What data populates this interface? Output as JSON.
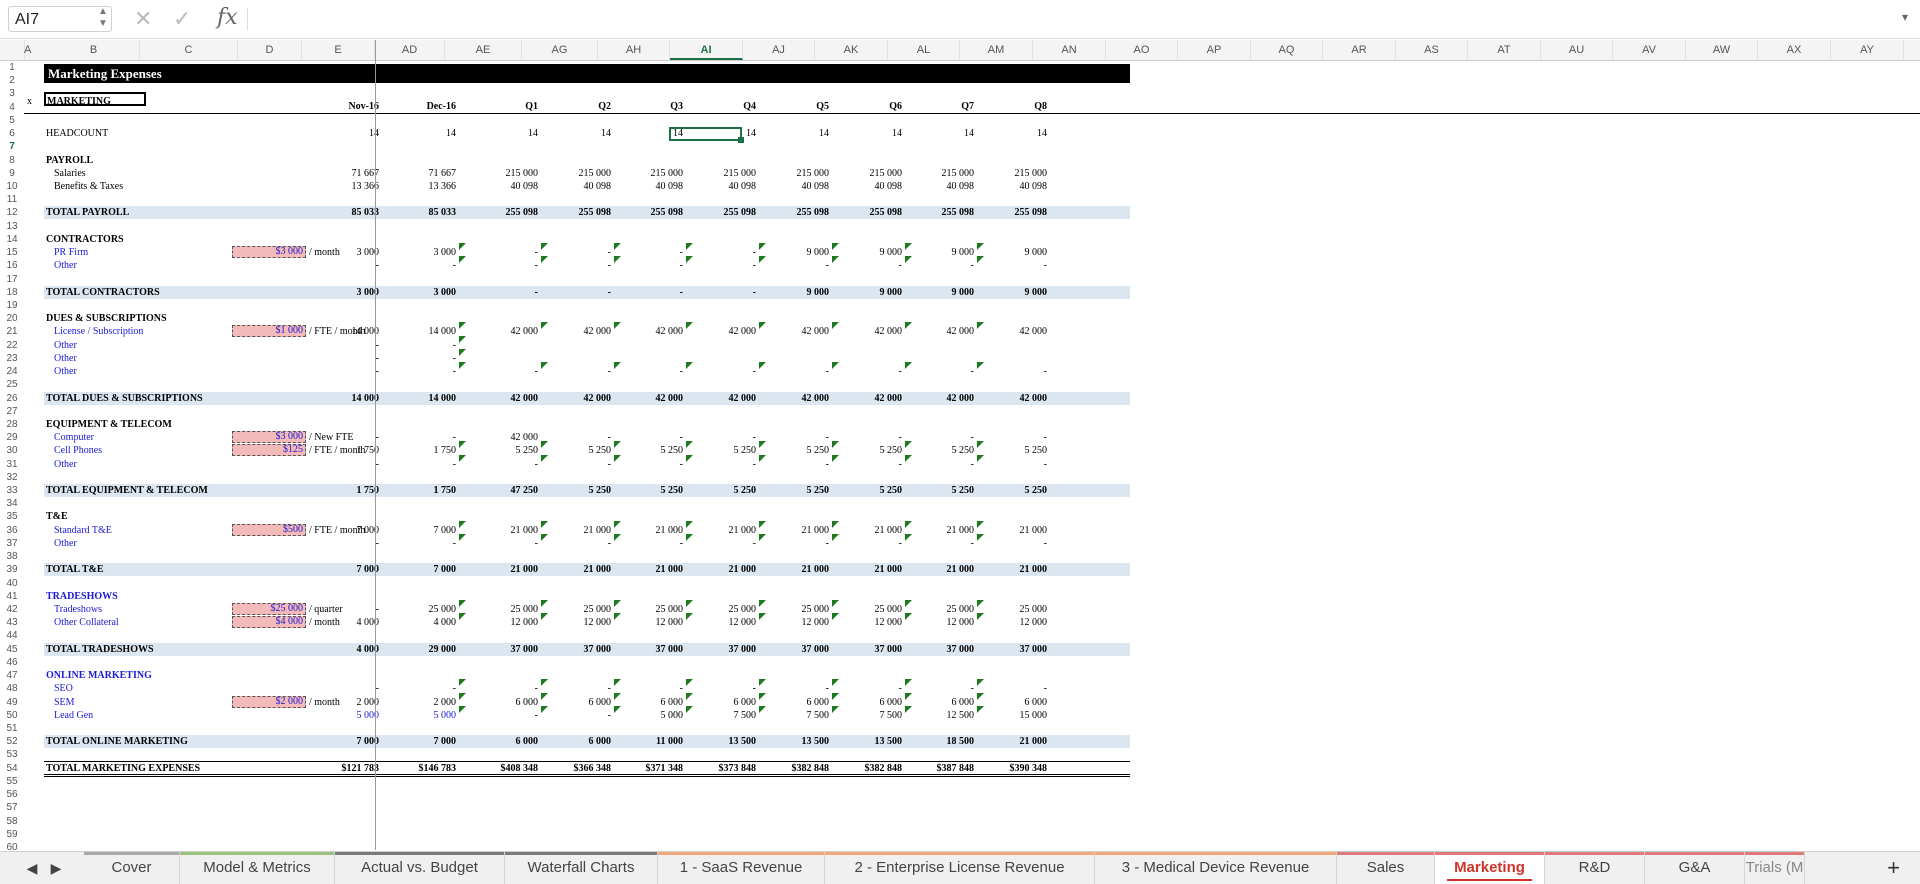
{
  "formula_bar": {
    "name_box": "AI7",
    "cancel": "✕",
    "enter": "✓",
    "fx": "fx",
    "content": ""
  },
  "columns": [
    "A",
    "B",
    "C",
    "D",
    "E",
    "AD",
    "AE",
    "AG",
    "AH",
    "AI",
    "AJ",
    "AK",
    "AL",
    "AM",
    "AN",
    "AO",
    "AP",
    "AQ",
    "AR",
    "AS",
    "AT",
    "AU",
    "AV",
    "AW",
    "AX",
    "AY"
  ],
  "selected_column": "AI",
  "selected_row": "7",
  "rows": [
    "1",
    "2",
    "3",
    "4",
    "5",
    "6",
    "7",
    "8",
    "9",
    "10",
    "11",
    "12",
    "13",
    "14",
    "15",
    "16",
    "17",
    "18",
    "19",
    "20",
    "21",
    "22",
    "23",
    "24",
    "25",
    "26",
    "27",
    "28",
    "29",
    "30",
    "31",
    "32",
    "33",
    "34",
    "35",
    "36",
    "37",
    "38",
    "39",
    "40",
    "41",
    "42",
    "43",
    "44",
    "45",
    "46",
    "47",
    "48",
    "49",
    "50",
    "51",
    "52",
    "53",
    "54",
    "55",
    "56",
    "57",
    "58",
    "59",
    "60"
  ],
  "sheet": {
    "title": "Marketing Expenses",
    "header_label": "MARKETING",
    "x_mark": "x",
    "periods": [
      "Nov-16",
      "Dec-16",
      "Q1",
      "Q2",
      "Q3",
      "Q4",
      "Q5",
      "Q6",
      "Q7",
      "Q8"
    ],
    "lines": [
      {
        "label": "HEADCOUNT",
        "kind": "plain",
        "values": [
          "14",
          "14",
          "14",
          "14",
          "14",
          "14",
          "14",
          "14",
          "14",
          "14"
        ]
      },
      {
        "label": "PAYROLL",
        "kind": "section"
      },
      {
        "label": "Salaries",
        "kind": "sub-black",
        "values": [
          "71 667",
          "71 667",
          "215 000",
          "215 000",
          "215 000",
          "215 000",
          "215 000",
          "215 000",
          "215 000",
          "215 000"
        ]
      },
      {
        "label": "Benefits & Taxes",
        "kind": "sub-black",
        "values": [
          "13 366",
          "13 366",
          "40 098",
          "40 098",
          "40 098",
          "40 098",
          "40 098",
          "40 098",
          "40 098",
          "40 098"
        ]
      },
      {
        "label": "TOTAL PAYROLL",
        "kind": "total",
        "values": [
          "85 033",
          "85 033",
          "255 098",
          "255 098",
          "255 098",
          "255 098",
          "255 098",
          "255 098",
          "255 098",
          "255 098"
        ]
      },
      {
        "label": "CONTRACTORS",
        "kind": "section"
      },
      {
        "label": "PR Firm",
        "kind": "sub",
        "assumption": "$3 000",
        "unit": "/ month",
        "values": [
          "3 000",
          "3 000",
          "-",
          "-",
          "-",
          "-",
          "9 000",
          "9 000",
          "9 000",
          "9 000"
        ]
      },
      {
        "label": "Other",
        "kind": "sub",
        "values": [
          "-",
          "-",
          "-",
          "-",
          "-",
          "-",
          "-",
          "-",
          "-",
          "-"
        ]
      },
      {
        "label": "TOTAL CONTRACTORS",
        "kind": "total",
        "values": [
          "3 000",
          "3 000",
          "-",
          "-",
          "-",
          "-",
          "9 000",
          "9 000",
          "9 000",
          "9 000"
        ]
      },
      {
        "label": "DUES & SUBSCRIPTIONS",
        "kind": "section"
      },
      {
        "label": "License / Subscription",
        "kind": "sub",
        "assumption": "$1 000",
        "unit": "/ FTE / month",
        "values": [
          "14 000",
          "14 000",
          "42 000",
          "42 000",
          "42 000",
          "42 000",
          "42 000",
          "42 000",
          "42 000",
          "42 000"
        ]
      },
      {
        "label": "Other",
        "kind": "sub",
        "values": [
          "-",
          "-",
          "",
          "",
          "",
          "",
          "",
          "",
          "",
          ""
        ]
      },
      {
        "label": "Other",
        "kind": "sub",
        "values": [
          "-",
          "-",
          "",
          "",
          "",
          "",
          "",
          "",
          "",
          ""
        ]
      },
      {
        "label": "Other",
        "kind": "sub",
        "values": [
          "-",
          "-",
          "-",
          "-",
          "-",
          "-",
          "-",
          "-",
          "-",
          "-"
        ]
      },
      {
        "label": "TOTAL DUES & SUBSCRIPTIONS",
        "kind": "total",
        "values": [
          "14 000",
          "14 000",
          "42 000",
          "42 000",
          "42 000",
          "42 000",
          "42 000",
          "42 000",
          "42 000",
          "42 000"
        ]
      },
      {
        "label": "EQUIPMENT & TELECOM",
        "kind": "section"
      },
      {
        "label": "Computer",
        "kind": "sub",
        "assumption": "$3 000",
        "unit": "/ New FTE",
        "values": [
          "-",
          "-",
          "42 000",
          "-",
          "-",
          "-",
          "-",
          "-",
          "-",
          "-"
        ]
      },
      {
        "label": "Cell Phones",
        "kind": "sub",
        "assumption": "$125",
        "unit": "/ FTE / month",
        "values": [
          "1 750",
          "1 750",
          "5 250",
          "5 250",
          "5 250",
          "5 250",
          "5 250",
          "5 250",
          "5 250",
          "5 250"
        ]
      },
      {
        "label": "Other",
        "kind": "sub",
        "values": [
          "-",
          "-",
          "-",
          "-",
          "-",
          "-",
          "-",
          "-",
          "-",
          "-"
        ]
      },
      {
        "label": "TOTAL EQUIPMENT & TELECOM",
        "kind": "total",
        "values": [
          "1 750",
          "1 750",
          "47 250",
          "5 250",
          "5 250",
          "5 250",
          "5 250",
          "5 250",
          "5 250",
          "5 250"
        ]
      },
      {
        "label": "T&E",
        "kind": "section"
      },
      {
        "label": "Standard T&E",
        "kind": "sub",
        "assumption": "$500",
        "unit": "/ FTE / month",
        "values": [
          "7 000",
          "7 000",
          "21 000",
          "21 000",
          "21 000",
          "21 000",
          "21 000",
          "21 000",
          "21 000",
          "21 000"
        ]
      },
      {
        "label": "Other",
        "kind": "sub",
        "values": [
          "-",
          "-",
          "-",
          "-",
          "-",
          "-",
          "-",
          "-",
          "-",
          "-"
        ]
      },
      {
        "label": "TOTAL T&E",
        "kind": "total",
        "values": [
          "7 000",
          "7 000",
          "21 000",
          "21 000",
          "21 000",
          "21 000",
          "21 000",
          "21 000",
          "21 000",
          "21 000"
        ]
      },
      {
        "label": "TRADESHOWS",
        "kind": "section-blue"
      },
      {
        "label": "Tradeshows",
        "kind": "sub",
        "assumption": "$25 000",
        "unit": "/ quarter",
        "values": [
          "-",
          "25 000",
          "25 000",
          "25 000",
          "25 000",
          "25 000",
          "25 000",
          "25 000",
          "25 000",
          "25 000"
        ]
      },
      {
        "label": "Other Collateral",
        "kind": "sub",
        "assumption": "$4 000",
        "unit": "/ month",
        "values": [
          "4 000",
          "4 000",
          "12 000",
          "12 000",
          "12 000",
          "12 000",
          "12 000",
          "12 000",
          "12 000",
          "12 000"
        ]
      },
      {
        "label": "TOTAL TRADESHOWS",
        "kind": "total",
        "values": [
          "4 000",
          "29 000",
          "37 000",
          "37 000",
          "37 000",
          "37 000",
          "37 000",
          "37 000",
          "37 000",
          "37 000"
        ]
      },
      {
        "label": "ONLINE MARKETING",
        "kind": "section-blue"
      },
      {
        "label": "SEO",
        "kind": "sub",
        "values": [
          "-",
          "-",
          "-",
          "-",
          "-",
          "-",
          "-",
          "-",
          "-",
          "-"
        ]
      },
      {
        "label": "SEM",
        "kind": "sub",
        "assumption": "$2 000",
        "unit": "/ month",
        "values": [
          "2 000",
          "2 000",
          "6 000",
          "6 000",
          "6 000",
          "6 000",
          "6 000",
          "6 000",
          "6 000",
          "6 000"
        ]
      },
      {
        "label": "Lead Gen",
        "kind": "sub",
        "values": [
          "5 000",
          "5 000",
          "-",
          "-",
          "5 000",
          "7 500",
          "7 500",
          "7 500",
          "12 500",
          "15 000"
        ]
      },
      {
        "label": "TOTAL ONLINE MARKETING",
        "kind": "total",
        "values": [
          "7 000",
          "7 000",
          "6 000",
          "6 000",
          "11 000",
          "13 500",
          "13 500",
          "13 500",
          "18 500",
          "21 000"
        ]
      },
      {
        "label": "TOTAL MARKETING EXPENSES",
        "kind": "grand",
        "values": [
          "$121 783",
          "$146 783",
          "$408 348",
          "$366 348",
          "$371 348",
          "$373 848",
          "$382 848",
          "$382 848",
          "$387 848",
          "$390 348"
        ]
      }
    ]
  },
  "tabs": [
    {
      "label": "Cover",
      "color": "#a9a9a9"
    },
    {
      "label": "Model & Metrics",
      "color": "#9bc27d"
    },
    {
      "label": "Actual vs. Budget",
      "color": "#7a7a7a"
    },
    {
      "label": "Waterfall Charts",
      "color": "#7a7a7a"
    },
    {
      "label": "1 - SaaS Revenue",
      "color": "#f0a878"
    },
    {
      "label": "2 - Enterprise License Revenue",
      "color": "#f0a878"
    },
    {
      "label": "3 - Medical Device Revenue",
      "color": "#f0a878"
    },
    {
      "label": "Sales",
      "color": "#e07a7a"
    },
    {
      "label": "Marketing",
      "color": "#e07a7a"
    },
    {
      "label": "R&D",
      "color": "#e07a7a"
    },
    {
      "label": "G&A",
      "color": "#e07a7a"
    },
    {
      "label": "Trials (M",
      "color": "#e07a7a"
    }
  ],
  "active_tab": "Marketing",
  "tab_nav": {
    "prev": "◀",
    "next": "▶",
    "add": "+"
  }
}
